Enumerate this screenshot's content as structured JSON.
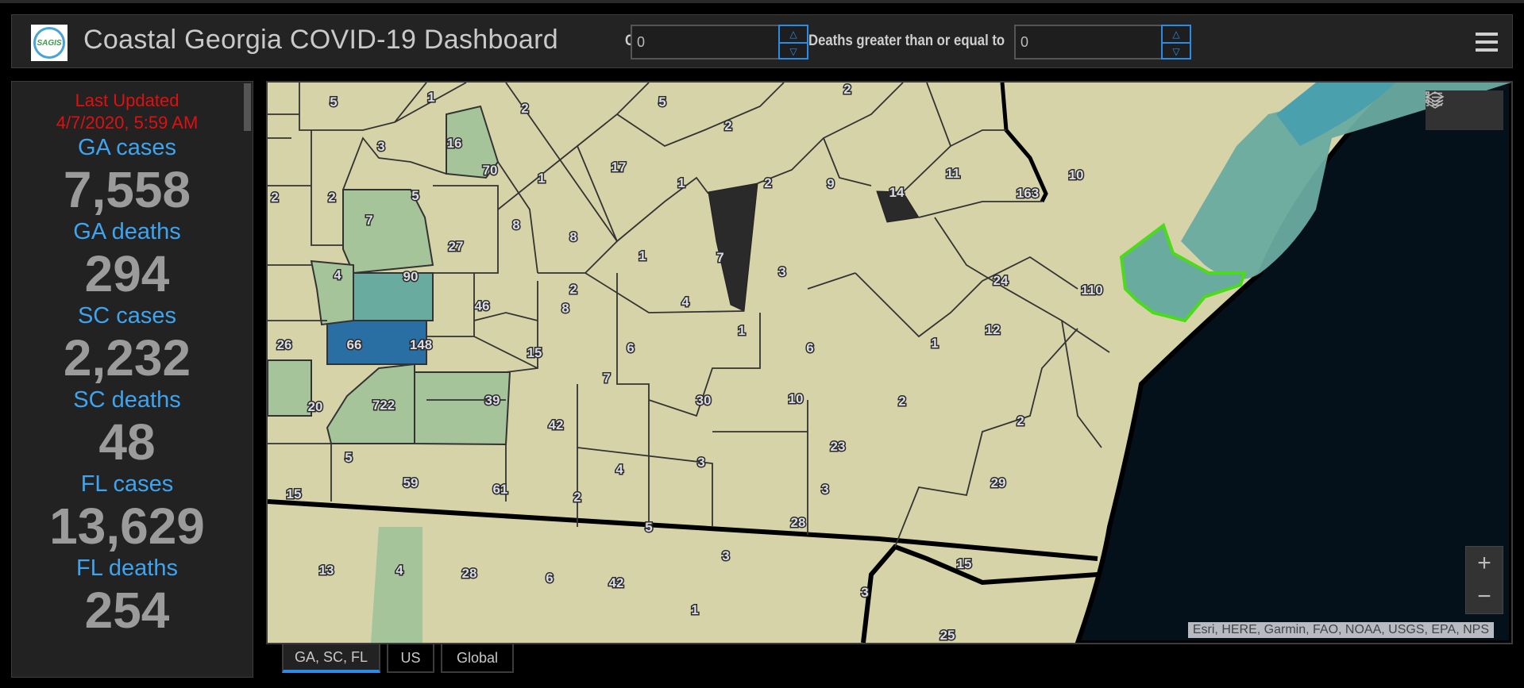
{
  "header": {
    "logo_text": "SAGIS",
    "title": "Coastal Georgia COVID-19 Dashboard",
    "filters": [
      {
        "label": "Cases greater than",
        "value": "0"
      },
      {
        "label": "Deaths greater than or equal to",
        "value": "0"
      }
    ],
    "spinner_up": "△",
    "spinner_down": "▽"
  },
  "sidebar": {
    "last_updated_label": "Last Updated",
    "last_updated_value": "4/7/2020, 5:59 AM",
    "stats": [
      {
        "label": "GA cases",
        "value": "7,558"
      },
      {
        "label": "GA deaths",
        "value": "294"
      },
      {
        "label": "SC cases",
        "value": "2,232"
      },
      {
        "label": "SC deaths",
        "value": "48"
      },
      {
        "label": "FL cases",
        "value": "13,629"
      },
      {
        "label": "FL deaths",
        "value": "254"
      }
    ]
  },
  "map": {
    "attribution": "Esri, HERE, Garmin, FAO, NOAA, USGS, EPA, NPS",
    "zoom_in": "+",
    "zoom_out": "−",
    "colors": {
      "land": "#d6d3a8",
      "low": "#a5c49a",
      "mid": "#6aaba0",
      "high": "#2a6fa3",
      "teal_coast": "#4aa0ac",
      "water": "#04101a",
      "nodata": "#2a2a2a",
      "selected_outline": "#4cdb1a"
    },
    "county_case_labels": [
      "5",
      "1",
      "2",
      "5",
      "2",
      "2",
      "3",
      "16",
      "70",
      "1",
      "17",
      "1",
      "2",
      "9",
      "11",
      "163",
      "10",
      "2",
      "2",
      "7",
      "5",
      "8",
      "8",
      "1",
      "7",
      "3",
      "14",
      "27",
      "90",
      "4",
      "8",
      "24",
      "110",
      "46",
      "2",
      "4",
      "1",
      "12",
      "1",
      "26",
      "66",
      "148",
      "6",
      "6",
      "15",
      "7",
      "20",
      "722",
      "39",
      "30",
      "10",
      "2",
      "42",
      "2",
      "23",
      "5",
      "59",
      "4",
      "3",
      "29",
      "15",
      "61",
      "2",
      "3",
      "5",
      "28",
      "13",
      "4",
      "28",
      "6",
      "42",
      "3",
      "15",
      "3",
      "1",
      "25"
    ]
  },
  "tabs": [
    {
      "label": "GA, SC, FL",
      "active": true
    },
    {
      "label": "US",
      "active": false
    },
    {
      "label": "Global",
      "active": false
    }
  ]
}
